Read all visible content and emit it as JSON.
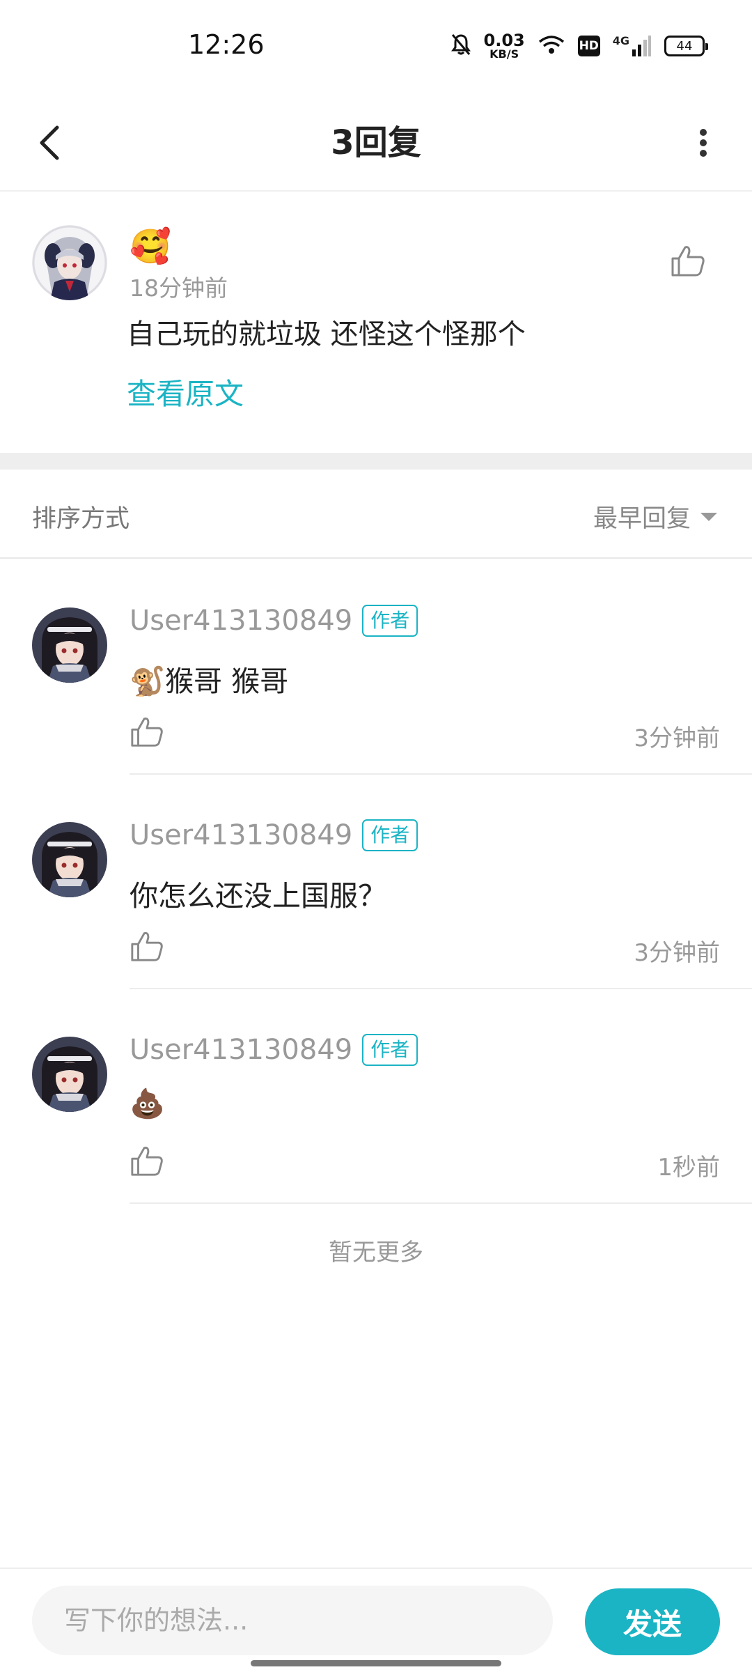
{
  "status_bar": {
    "time": "12:26",
    "net_speed_value": "0.03",
    "net_speed_unit": "KB/S",
    "hd": "HD",
    "signal": "4G",
    "battery": "44"
  },
  "header": {
    "title": "3回复"
  },
  "original_comment": {
    "emoji": "🥰",
    "time": "18分钟前",
    "text": "自己玩的就垃圾 还怪这个怪那个",
    "view_original": "查看原文"
  },
  "sort": {
    "label": "排序方式",
    "selected": "最早回复"
  },
  "replies": [
    {
      "user": "User413130849",
      "badge": "作者",
      "content": "🐒猴哥 猴哥",
      "time": "3分钟前"
    },
    {
      "user": "User413130849",
      "badge": "作者",
      "content": "你怎么还没上国服？",
      "time": "3分钟前"
    },
    {
      "user": "User413130849",
      "badge": "作者",
      "content": "💩",
      "time": "1秒前"
    }
  ],
  "no_more": "暂无更多",
  "input": {
    "placeholder": "写下你的想法...",
    "send": "发送"
  },
  "colors": {
    "accent": "#1bb4c4"
  }
}
